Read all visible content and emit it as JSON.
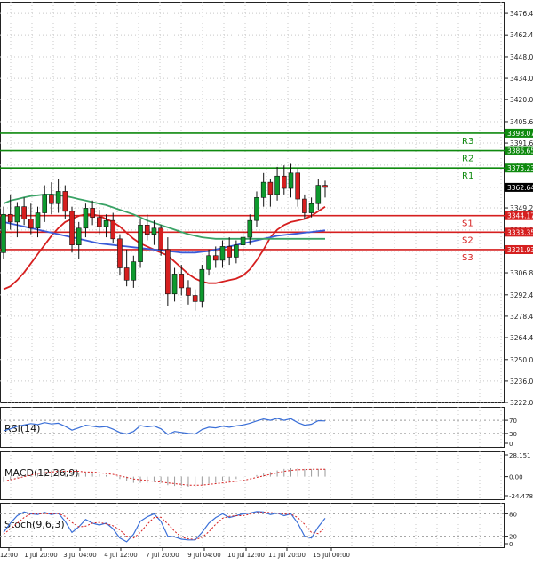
{
  "chart_data": {
    "type": "candlestick",
    "x_ticks": [
      "12:00",
      "1 Jul 20:00",
      "3 Jul 04:00",
      "4 Jul 12:00",
      "7 Jul 20:00",
      "9 Jul 04:00",
      "10 Jul 12:00",
      "11 Jul 20:00",
      "15 Jul 00:00"
    ],
    "price_axis": {
      "ylim": [
        3222.0,
        3484.0
      ],
      "ticks": [
        "3476.40",
        "3462.40",
        "3448.00",
        "3434.00",
        "3420.00",
        "3405.60",
        "3391.60",
        "3377.20",
        "3362.64",
        "3349.20",
        "3334.80",
        "3320.80",
        "3306.80",
        "3292.40",
        "3278.40",
        "3264.40",
        "3250.00",
        "3236.00",
        "3222.00"
      ],
      "current_price": "3362.64"
    },
    "levels": [
      {
        "label": "R3",
        "value": 3398.07,
        "tag": "3398.07",
        "color": "#0f8a0f"
      },
      {
        "label": "R2",
        "value": 3386.65,
        "tag": "3386.65",
        "color": "#0f8a0f"
      },
      {
        "label": "R1",
        "value": 3375.23,
        "tag": "3375.23",
        "color": "#0f8a0f"
      },
      {
        "label": "S1",
        "value": 3344.17,
        "tag": "3344.17",
        "color": "#d61f1f"
      },
      {
        "label": "S2",
        "value": 3333.35,
        "tag": "3333.35",
        "color": "#d61f1f"
      },
      {
        "label": "S3",
        "value": 3321.93,
        "tag": "3321.93",
        "color": "#d61f1f"
      }
    ],
    "candles": [
      [
        3320,
        3350,
        3316,
        3345
      ],
      [
        3345,
        3358,
        3335,
        3340
      ],
      [
        3340,
        3353,
        3330,
        3350
      ],
      [
        3350,
        3356,
        3338,
        3342
      ],
      [
        3342,
        3352,
        3332,
        3336
      ],
      [
        3336,
        3350,
        3330,
        3346
      ],
      [
        3346,
        3364,
        3340,
        3358
      ],
      [
        3358,
        3366,
        3345,
        3352
      ],
      [
        3352,
        3368,
        3346,
        3360
      ],
      [
        3360,
        3364,
        3342,
        3347
      ],
      [
        3347,
        3350,
        3320,
        3325
      ],
      [
        3325,
        3340,
        3316,
        3336
      ],
      [
        3336,
        3352,
        3330,
        3349
      ],
      [
        3349,
        3354,
        3338,
        3343
      ],
      [
        3343,
        3348,
        3332,
        3337
      ],
      [
        3337,
        3345,
        3330,
        3341
      ],
      [
        3341,
        3346,
        3326,
        3329
      ],
      [
        3329,
        3332,
        3305,
        3310
      ],
      [
        3310,
        3322,
        3298,
        3302
      ],
      [
        3302,
        3318,
        3297,
        3314
      ],
      [
        3314,
        3342,
        3310,
        3338
      ],
      [
        3338,
        3345,
        3328,
        3332
      ],
      [
        3332,
        3341,
        3325,
        3336
      ],
      [
        3336,
        3338,
        3318,
        3322
      ],
      [
        3322,
        3330,
        3285,
        3293
      ],
      [
        3293,
        3310,
        3288,
        3306
      ],
      [
        3306,
        3312,
        3292,
        3297
      ],
      [
        3297,
        3302,
        3286,
        3292
      ],
      [
        3292,
        3296,
        3282,
        3288
      ],
      [
        3288,
        3312,
        3284,
        3309
      ],
      [
        3309,
        3322,
        3305,
        3318
      ],
      [
        3318,
        3324,
        3310,
        3315
      ],
      [
        3315,
        3328,
        3310,
        3324
      ],
      [
        3324,
        3330,
        3312,
        3317
      ],
      [
        3317,
        3328,
        3313,
        3325
      ],
      [
        3325,
        3334,
        3318,
        3330
      ],
      [
        3330,
        3345,
        3325,
        3341
      ],
      [
        3341,
        3360,
        3337,
        3356
      ],
      [
        3356,
        3372,
        3350,
        3366
      ],
      [
        3366,
        3368,
        3350,
        3358
      ],
      [
        3358,
        3376,
        3354,
        3370
      ],
      [
        3370,
        3377,
        3358,
        3362
      ],
      [
        3362,
        3378,
        3356,
        3372
      ],
      [
        3372,
        3375,
        3350,
        3355
      ],
      [
        3355,
        3358,
        3342,
        3346
      ],
      [
        3346,
        3356,
        3343,
        3352
      ],
      [
        3352,
        3368,
        3348,
        3364
      ],
      [
        3364,
        3367,
        3356,
        3362.64
      ]
    ],
    "moving_averages": [
      {
        "color": "#d61f1f",
        "values": [
          3296,
          3298,
          3302,
          3307,
          3313,
          3319,
          3325,
          3331,
          3336,
          3340,
          3342,
          3344,
          3345,
          3345,
          3344,
          3342,
          3340,
          3337,
          3333,
          3329,
          3326,
          3324,
          3322,
          3320,
          3318,
          3314,
          3310,
          3306,
          3303,
          3301,
          3300,
          3300,
          3301,
          3302,
          3303,
          3305,
          3309,
          3315,
          3322,
          3330,
          3335,
          3338,
          3340,
          3341,
          3342,
          3344,
          3347,
          3350
        ]
      },
      {
        "color": "#3b5bd8",
        "values": [
          3340,
          3339,
          3338,
          3337,
          3336,
          3335,
          3334,
          3333,
          3332,
          3331,
          3330,
          3329,
          3328,
          3327,
          3326,
          3325.5,
          3325,
          3324.5,
          3324,
          3323.5,
          3323,
          3322.5,
          3322,
          3321.5,
          3321,
          3320.5,
          3320,
          3320,
          3320,
          3320.5,
          3321,
          3322,
          3323,
          3324,
          3325,
          3326,
          3327,
          3328,
          3329,
          3330,
          3331,
          3331.5,
          3332,
          3332.5,
          3333,
          3333.5,
          3334,
          3334.5
        ]
      },
      {
        "color": "#3aa366",
        "values": [
          3352,
          3354,
          3355,
          3356,
          3357,
          3357.5,
          3358,
          3358,
          3357.5,
          3357,
          3356,
          3355,
          3354,
          3353,
          3352,
          3351,
          3349.5,
          3348,
          3346.5,
          3345,
          3343,
          3341,
          3339.5,
          3338,
          3336.5,
          3335,
          3333.5,
          3332,
          3331,
          3330,
          3329.5,
          3329,
          3329,
          3329,
          3329,
          3329,
          3329,
          3329,
          3329,
          3329,
          3329,
          3329,
          3329,
          3329,
          3329,
          3329,
          3329,
          3329
        ]
      }
    ],
    "indicators": [
      {
        "name": "RSI(14)",
        "ylim": [
          0,
          100
        ],
        "ticks": [
          "70",
          "30",
          "0"
        ],
        "tick_values": [
          70,
          30,
          0
        ],
        "color": "#3a6fd8",
        "values": [
          38,
          44,
          52,
          56,
          60,
          57,
          63,
          59,
          61,
          52,
          40,
          47,
          55,
          52,
          49,
          51,
          43,
          33,
          28,
          36,
          54,
          50,
          53,
          44,
          27,
          36,
          33,
          30,
          28,
          42,
          49,
          47,
          52,
          49,
          53,
          56,
          61,
          68,
          74,
          70,
          76,
          70,
          75,
          63,
          55,
          58,
          69,
          68
        ]
      },
      {
        "name": "MACD(12,26,9)",
        "ylim": [
          -24.478,
          28.151
        ],
        "ticks": [
          "28.151",
          "0.00",
          "-24.478"
        ],
        "tick_values": [
          28.151,
          0,
          -24.478
        ],
        "histogram": [
          -7,
          -4,
          -1,
          1,
          3,
          5,
          7,
          8,
          9,
          8,
          6,
          5,
          5,
          4,
          3,
          2,
          0,
          -3,
          -6,
          -8,
          -8,
          -8,
          -7,
          -8,
          -11,
          -12,
          -12,
          -13,
          -13,
          -11,
          -9,
          -8,
          -6,
          -5,
          -3,
          -2,
          0,
          2,
          4,
          6,
          8,
          10,
          11,
          11,
          10,
          10,
          10,
          10
        ],
        "signal": [
          -6,
          -4,
          -2,
          0,
          2,
          4,
          5,
          6,
          7,
          7,
          7,
          7,
          6,
          6,
          5,
          4,
          3,
          1,
          -1,
          -3,
          -4,
          -5,
          -6,
          -7,
          -8,
          -9,
          -10,
          -11,
          -11,
          -11,
          -10,
          -9,
          -8,
          -7,
          -6,
          -5,
          -3,
          -1,
          1,
          3,
          5,
          7,
          8,
          9,
          9,
          9.5,
          9.5,
          9.5
        ],
        "signal_color": "#d61f1f",
        "hist_color": "#9a9a9a"
      },
      {
        "name": "Stoch(9,6,3)",
        "ylim": [
          0,
          100
        ],
        "ticks": [
          "80",
          "20",
          "0"
        ],
        "tick_values": [
          80,
          20,
          0
        ],
        "k": [
          30,
          55,
          75,
          85,
          80,
          78,
          84,
          78,
          82,
          60,
          30,
          45,
          65,
          55,
          50,
          55,
          40,
          15,
          5,
          25,
          60,
          72,
          80,
          60,
          20,
          18,
          12,
          10,
          10,
          30,
          55,
          70,
          80,
          70,
          75,
          80,
          82,
          86,
          85,
          78,
          82,
          75,
          80,
          55,
          20,
          15,
          45,
          68
        ],
        "d": [
          25,
          40,
          55,
          70,
          80,
          80,
          80,
          80,
          81,
          73,
          57,
          45,
          47,
          55,
          57,
          53,
          48,
          37,
          20,
          15,
          30,
          52,
          70,
          71,
          53,
          33,
          17,
          13,
          11,
          17,
          32,
          52,
          68,
          73,
          75,
          75,
          79,
          83,
          84,
          83,
          82,
          79,
          79,
          70,
          52,
          30,
          27,
          43
        ],
        "k_color": "#3a6fd8",
        "d_color": "#d61f1f"
      }
    ]
  }
}
